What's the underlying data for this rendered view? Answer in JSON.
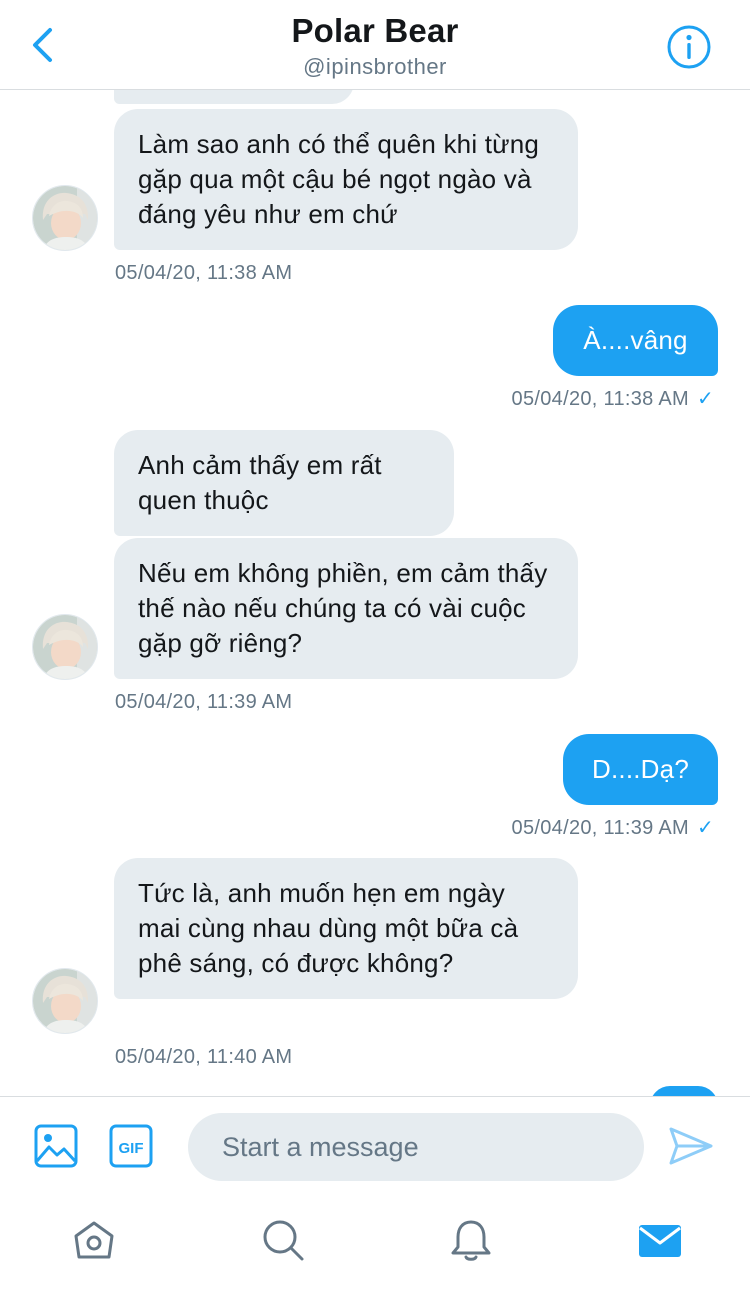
{
  "header": {
    "title": "Polar Bear",
    "handle": "@ipinsbrother",
    "back_icon": "chevron-left-icon",
    "info_icon": "info-icon"
  },
  "conversation": {
    "messages": [
      {
        "direction": "incoming",
        "text": "Làm sao anh có thể quên khi từng gặp qua một cậu bé ngọt ngào và đáng yêu như em chứ"
      },
      {
        "direction": "outgoing",
        "text": "À....vâng"
      },
      {
        "direction": "incoming",
        "text": "Anh cảm thấy em rất quen thuộc"
      },
      {
        "direction": "incoming",
        "text": "Nếu em không phiền, em cảm thấy thế nào nếu chúng ta có vài cuộc gặp gỡ riêng?"
      },
      {
        "direction": "outgoing",
        "text": "D....Dạ?"
      },
      {
        "direction": "incoming",
        "text": "Tức là, anh muốn hẹn em ngày mai cùng nhau dùng một bữa cà phê sáng, có được không?"
      }
    ],
    "timestamps": [
      "05/04/20, 11:38 AM",
      "05/04/20, 11:38 AM",
      "05/04/20, 11:39 AM",
      "05/04/20, 11:39 AM",
      "05/04/20, 11:40 AM"
    ],
    "read_mark": "✓"
  },
  "composer": {
    "placeholder": "Start a message",
    "gif_label": "GIF",
    "image_icon": "image-icon",
    "send_icon": "send-icon"
  },
  "tabbar": {
    "tabs": [
      "home-icon",
      "search-icon",
      "bell-icon",
      "mail-icon"
    ],
    "active": "mail-icon"
  },
  "colors": {
    "accent": "#1da1f2",
    "incoming_bubble": "#e6ecf0",
    "secondary_text": "#657786"
  }
}
